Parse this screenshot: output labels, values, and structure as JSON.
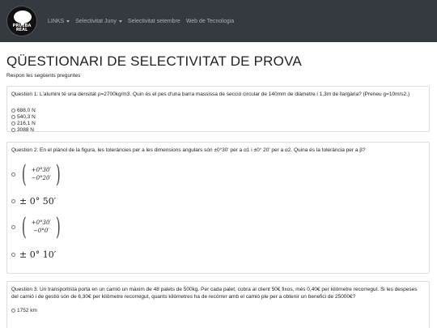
{
  "navbar": {
    "logo_text": "PRUEBA\nREAL",
    "links": [
      {
        "label": "LINKS",
        "dropdown": true
      },
      {
        "label": "Selectivitat Juny",
        "dropdown": true
      },
      {
        "label": "Selectivitat setembre",
        "dropdown": false
      },
      {
        "label": "Web de Tecnologia",
        "dropdown": false
      }
    ]
  },
  "page": {
    "title": "QÜESTIONARI DE SELECTIVITAT DE PROVA",
    "subtitle": "Respon les següents preguntes"
  },
  "questions": [
    {
      "text": "Question 1: L'alumini té una densitat ρ=2700kg/m3. Quin és el pes d'una barra massissa de secció circular de 140mm de diàmetre i 1,3m de llargària? (Preneu g=10m/s2.)",
      "options": [
        "688,0 N",
        "540,3 N",
        "216,1 N",
        "3088 N"
      ]
    },
    {
      "text": "Question 2: En el plànol de la figura, les toleràncies per a les dimensions angulars són ±0°30' per a α1 i ±0° 20' per a α2. Quina és la tolerància per a β?",
      "options": [
        {
          "type": "matrix",
          "top": "+0°30′",
          "bottom": "−0°20′"
        },
        {
          "type": "text",
          "value": "± 0° 50′"
        },
        {
          "type": "matrix",
          "top": "+0°30′",
          "bottom": "−0°0′"
        },
        {
          "type": "text",
          "value": "± 0° 10′"
        }
      ]
    },
    {
      "text": "Question 3: Un transportista porta en un camió un màxim de 48 palets de 500kg. Per cada palet, cobra al client 50€ fixos, més 0,40€ per kilòmetre recorregut. Si les despeses del camió i de gestió són de 6,30€ per kilòmetre recorregut, quants kilòmetres ha de recórrer amb el camió ple per a obtenir un benefici de 25000€?",
      "options": [
        "1752 km"
      ]
    }
  ]
}
